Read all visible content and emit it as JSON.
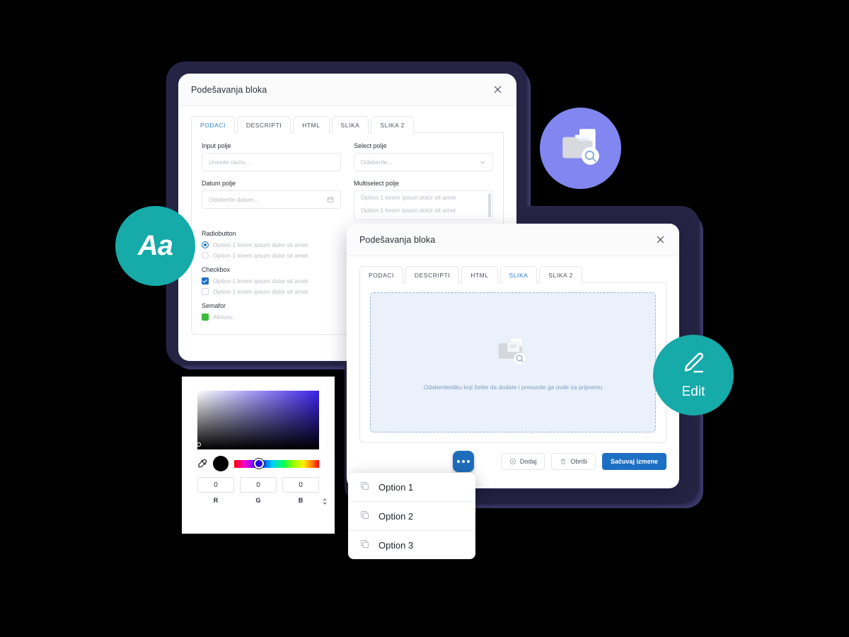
{
  "dialog1": {
    "title": "Podešavanja bloka",
    "close_icon": "close-icon",
    "tabs": [
      {
        "label": "PODACI",
        "active": true
      },
      {
        "label": "DESCRIPTI",
        "active": false
      },
      {
        "label": "HTML",
        "active": false
      },
      {
        "label": "SLIKA",
        "active": false
      },
      {
        "label": "SLIKA 2",
        "active": false
      }
    ],
    "fields": {
      "input_label": "Input polje",
      "input_placeholder": "Unesite naziv...",
      "select_label": "Select polje",
      "select_placeholder": "Odaberite...",
      "date_label": "Datum polje",
      "date_placeholder": "Odaberite datum...",
      "multiselect_label": "Multiselect polje",
      "multiselect_options": [
        "Option 1 lorem ipsum dolor sit amet",
        "Option 1 lorem ipsum dolor sit amet"
      ]
    },
    "radiobutton": {
      "title": "Radiobutton",
      "options": [
        {
          "label": "Option 1 lorem ipsum dolor sit amet",
          "selected": true
        },
        {
          "label": "Option 1 lorem ipsum dolor sit amet",
          "selected": false
        }
      ]
    },
    "checkbox": {
      "title": "Checkbox",
      "options": [
        {
          "label": "Option 1 lorem ipsum dolor sit amet",
          "checked": true
        },
        {
          "label": "Option 1 lorem ipsum dolor sit amet",
          "checked": false
        }
      ]
    },
    "semafor": {
      "title": "Semafor",
      "status_label": "Aktivno",
      "status_color": "#3dbb3d"
    }
  },
  "dialog2": {
    "title": "Podešavanja bloka",
    "close_icon": "close-icon",
    "tabs": [
      {
        "label": "PODACI",
        "active": false
      },
      {
        "label": "DESCRIPTI",
        "active": false
      },
      {
        "label": "HTML",
        "active": false
      },
      {
        "label": "SLIKA",
        "active": true
      },
      {
        "label": "SLIKA 2",
        "active": false
      }
    ],
    "dropzone": {
      "text": "Odaberitesliku koji želite da dodate i prevucite ga ovde za pripremu",
      "icon": "folder-search-icon"
    },
    "buttons": {
      "add": "Dodaj",
      "delete": "Obriši",
      "save": "Sačuvaj izmene"
    }
  },
  "fab": {
    "icon": "more-horizontal-icon",
    "color": "#1e6cbc"
  },
  "menu": {
    "items": [
      {
        "label": "Option 1",
        "icon": "copy-icon"
      },
      {
        "label": "Option 2",
        "icon": "copy-icon"
      },
      {
        "label": "Option 3",
        "icon": "copy-icon"
      }
    ]
  },
  "color_picker": {
    "eyedropper_icon": "eyedropper-icon",
    "current_color": "#000000",
    "channels": [
      {
        "label": "R",
        "value": "0"
      },
      {
        "label": "G",
        "value": "0"
      },
      {
        "label": "B",
        "value": "0"
      }
    ],
    "spinner": "⌃⌄"
  },
  "badges": {
    "typography": {
      "label": "Aa",
      "color": "#16aaa9"
    },
    "edit": {
      "label": "Edit",
      "icon": "pencil-icon",
      "color": "#16aaa9"
    },
    "folder": {
      "icon": "folder-search-icon",
      "color": "#8186f0"
    }
  },
  "theme": {
    "accent_blue": "#1d6fc4",
    "teal": "#16aaa9",
    "purple": "#8186f0",
    "frame_navy": "#262444"
  }
}
